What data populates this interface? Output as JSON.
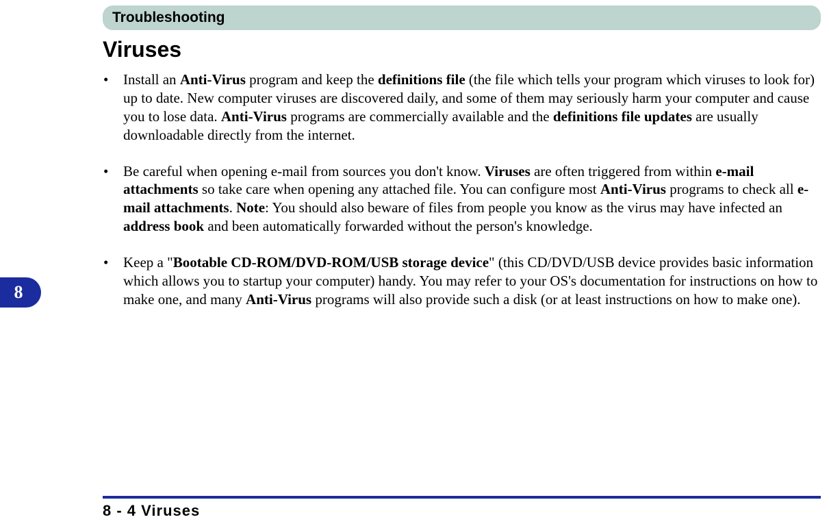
{
  "chapterTab": "8",
  "section": {
    "banner": "Troubleshooting",
    "title": "Viruses"
  },
  "bullets": [
    {
      "parts": [
        {
          "t": "Install an ",
          "b": false
        },
        {
          "t": "Anti-Virus",
          "b": true
        },
        {
          "t": " program and keep the ",
          "b": false
        },
        {
          "t": "definitions file",
          "b": true
        },
        {
          "t": " (the file which tells your program which viruses to look for) up to date. New computer viruses are discovered daily, and some of them may seriously harm your computer and cause you to lose data. ",
          "b": false
        },
        {
          "t": "Anti-Virus",
          "b": true
        },
        {
          "t": " programs are commercially available and the ",
          "b": false
        },
        {
          "t": "defini­tions file updates",
          "b": true
        },
        {
          "t": " are usually downloadable directly from the internet.",
          "b": false
        }
      ]
    },
    {
      "parts": [
        {
          "t": "Be careful when opening e-mail from sources you don't know. ",
          "b": false
        },
        {
          "t": "Viruses",
          "b": true
        },
        {
          "t": " are often triggered from within ",
          "b": false
        },
        {
          "t": "e-mail attachments",
          "b": true
        },
        {
          "t": " so take care when opening any attached file. You can configure most ",
          "b": false
        },
        {
          "t": "Anti-Virus",
          "b": true
        },
        {
          "t": " pro­grams to check all ",
          "b": false
        },
        {
          "t": "e-mail attachments",
          "b": true
        },
        {
          "t": ". ",
          "b": false
        },
        {
          "t": "Note",
          "b": true
        },
        {
          "t": ": You should also beware of files from people you know as the virus may have infected an ",
          "b": false
        },
        {
          "t": "address book",
          "b": true
        },
        {
          "t": " and been automatically forwarded without the person's knowl­edge.",
          "b": false
        }
      ]
    },
    {
      "parts": [
        {
          "t": "Keep a \"",
          "b": false
        },
        {
          "t": "Bootable CD-ROM/DVD-ROM/USB storage device",
          "b": true
        },
        {
          "t": "\" (this CD/DVD/USB device provides basic information which allows you to startup your computer) handy. You may refer to your OS's documentation for instructions on how to make one, and many ",
          "b": false
        },
        {
          "t": "Anti-Virus",
          "b": true
        },
        {
          "t": " programs will also provide such a disk (or at least instructions on how to make one).",
          "b": false
        }
      ]
    }
  ],
  "footer": "8 - 4 Viruses"
}
